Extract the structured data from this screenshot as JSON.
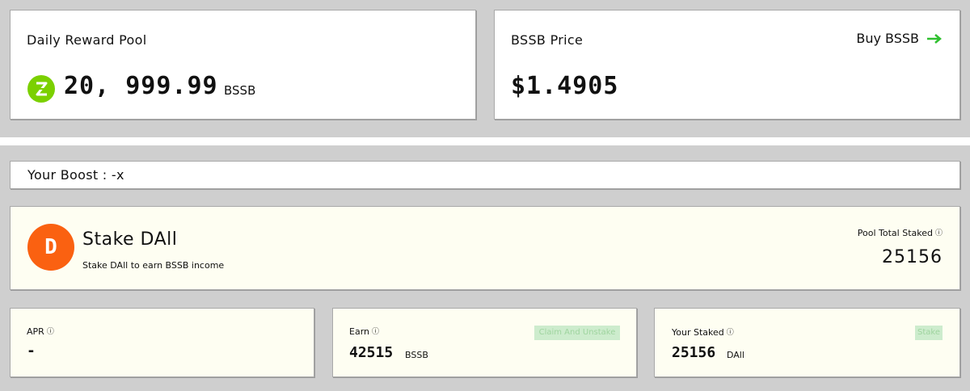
{
  "reward_pool": {
    "label": "Daily Reward Pool",
    "amount": "20, 999.99",
    "unit": "BSSB"
  },
  "price": {
    "label": "BSSB Price",
    "value": "$1.4905",
    "buy_label": "Buy BSSB",
    "buy_icon": "arrow-right-icon"
  },
  "boost": {
    "label": "Your Boost : -x"
  },
  "stake": {
    "badge_letter": "D",
    "title": "Stake DAll",
    "subtitle": "Stake DAll to earn BSSB income",
    "pool_total_label": "Pool Total Staked",
    "pool_total_value": "25156"
  },
  "apr": {
    "label": "APR",
    "value": "-"
  },
  "earn": {
    "label": "Earn",
    "value": "42515",
    "unit": "BSSB",
    "button": "Claim And Unstake"
  },
  "your_staked": {
    "label": "Your Staked",
    "value": "25156",
    "unit": "DAll",
    "button": "Stake"
  },
  "colors": {
    "brand_green": "#7bd000",
    "accent_orange": "#fa6111",
    "buy_arrow": "#2fc02f"
  }
}
